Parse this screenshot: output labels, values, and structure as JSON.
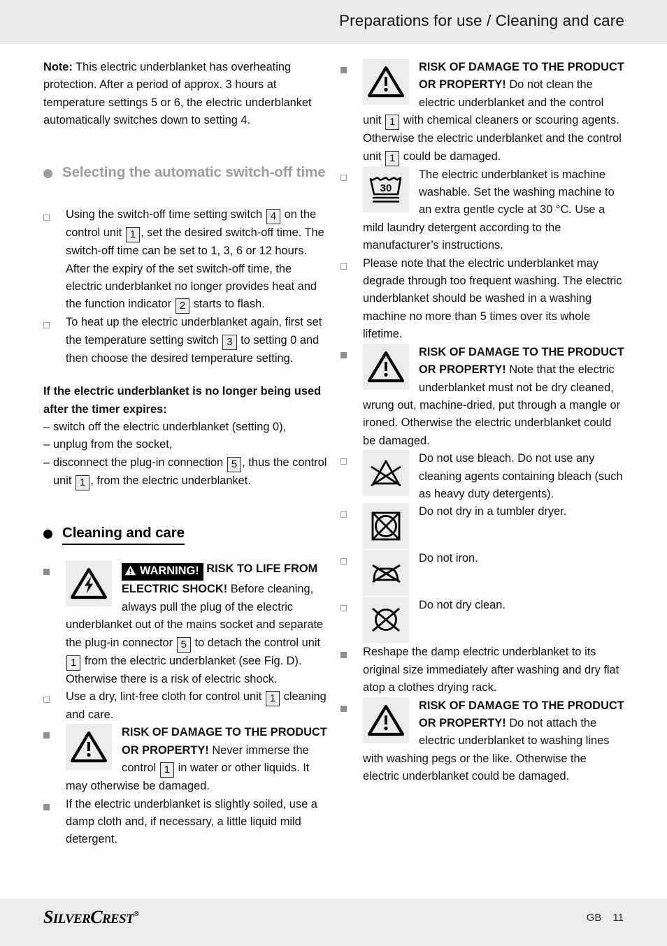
{
  "header": {
    "title": "Preparations for use / Cleaning and care"
  },
  "left": {
    "note": {
      "label": "Note:",
      "text": " This electric underblanket has overheating protection. After a period of approx. 3 hours at temperature settings 5 or 6, the electric underblanket automatically switches down to setting 4."
    },
    "section_switchoff": "Selecting the automatic switch-off time",
    "item1": {
      "a": "Using the switch-off time setting switch ",
      "ref1": "4",
      "b": " on the control unit ",
      "ref2": "1",
      "c": ", set the desired switch-off time. The switch-off time can be set to 1, 3, 6 or 12 hours. After the expiry of the set switch-off time, the electric underblanket no longer provides heat and the function indicator ",
      "ref3": "2",
      "d": " starts to flash."
    },
    "item2": {
      "a": "To heat up the electric underblanket again, first set the temperature setting switch ",
      "ref1": "3",
      "b": " to setting 0 and then choose the desired temperature setting."
    },
    "timer_heading": "If the electric underblanket is no longer being used after the timer expires:",
    "dash1": "switch off the electric underblanket (setting 0),",
    "dash2": "unplug from the socket,",
    "dash3": {
      "a": "disconnect the plug-in connection ",
      "ref1": "5",
      "b": ", thus the control unit ",
      "ref2": "1",
      "c": ", from the electric underblanket."
    },
    "section_cleaning": "Cleaning and care",
    "shock_warning": {
      "badge": "WARNING!",
      "bold": "RISK TO LIFE FROM ELECTRIC SHOCK!",
      "a": " Before cleaning, always pull the plug of the electric underblanket out of the mains socket and separate the plug-in connector ",
      "ref1": "5",
      "b": " to detach the control unit ",
      "ref2": "1",
      "c": " from the electric underblanket (see Fig. D). Otherwise there is a risk of electric shock."
    },
    "dry_cloth": {
      "a": "Use a dry, lint-free cloth for control unit ",
      "ref1": "1",
      "b": " cleaning and care."
    },
    "immerse_warning": {
      "bold": "RISK OF DAMAGE TO THE PRODUCT OR PROPERTY!",
      "a": " Never immerse the control ",
      "ref1": "1",
      "b": " in water or other liquids. It may otherwise be damaged."
    },
    "soiled": "If the electric underblanket is slightly soiled, use a damp cloth and, if necessary, a little liquid mild detergent."
  },
  "right": {
    "chemical_warning": {
      "bold": "RISK OF DAMAGE TO THE PRODUCT OR PROPERTY!",
      "a": " Do not clean the electric underblanket and the control unit ",
      "ref1": "1",
      "b": " with chemical cleaners or scouring agents. Otherwise the electric underblanket and the control unit ",
      "ref2": "1",
      "c": " could be damaged."
    },
    "machine_wash": {
      "symbol_temp": "30",
      "text": "The electric underblanket is machine washable. Set the washing machine to an extra gentle cycle at 30 °C. Use a mild laundry detergent according to the manufacturer’s instructions."
    },
    "degrade": "Please note that the electric underblanket may degrade through too frequent washing. The electric underblanket should be washed in a washing machine no more than 5 times over its whole lifetime.",
    "drycleaned_warning": {
      "bold": "RISK OF DAMAGE TO THE PRODUCT OR PROPERTY!",
      "a": " Note that the electric underblanket must not be dry cleaned, wrung out, machine-dried, put through a mangle or ironed. Otherwise the electric underblanket could be damaged."
    },
    "no_bleach": "Do not use bleach. Do not use any cleaning agents containing bleach (such as heavy duty detergents).",
    "no_tumble": "Do not dry in a tumbler dryer.",
    "no_iron": "Do not iron.",
    "no_dryclean": "Do not dry clean.",
    "reshape": "Reshape the damp electric underblanket to its original size immediately after washing and dry flat atop a clothes drying rack.",
    "pegs_warning": {
      "bold": "RISK OF DAMAGE TO THE PRODUCT OR PROPERTY!",
      "a": " Do not attach the electric underblanket to washing lines with washing pegs or the like. Otherwise the electric underblanket could be damaged."
    }
  },
  "footer": {
    "logo_part1": "S",
    "logo_part2": "ILVER",
    "logo_part3": "C",
    "logo_part4": "REST",
    "logo_reg": "®",
    "lang": "GB",
    "page": "11"
  }
}
